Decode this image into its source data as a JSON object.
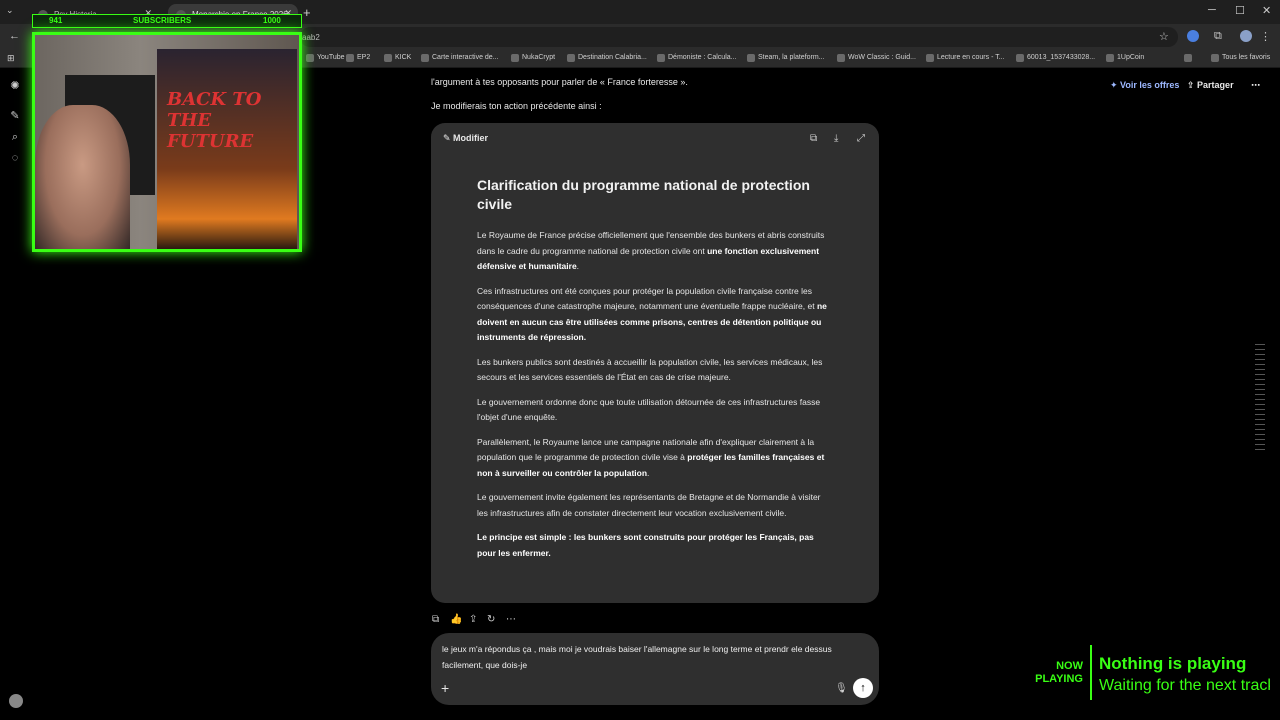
{
  "browser": {
    "tabs": [
      {
        "label": "Psy Historia"
      },
      {
        "label": "Monarchie en France 2026"
      }
    ],
    "url_fragment": "aab2",
    "bookmarks": [
      "YouTube",
      "EP2",
      "KICK",
      "Carte interactive de...",
      "NukaCrypt",
      "Destination Calabria...",
      "Démoniste : Calcula...",
      "Steam, la plateform...",
      "WoW Classic : Guid...",
      "Lecture en cours - T...",
      "60013_1537433028...",
      "1UpCoin"
    ],
    "all_favorites": "Tous les favoris"
  },
  "header": {
    "offers_label": "Voir les offres",
    "share_label": "Partager"
  },
  "conversation": {
    "prev_line": "l'argument à tes opposants pour parler de « France forteresse ».",
    "intro_line": "Je modifierais ton action précédente ainsi :"
  },
  "canvas": {
    "edit_label": "Modifier",
    "title": "Clarification du programme national de protection civile",
    "p1_a": "Le Royaume de France précise officiellement que l'ensemble des bunkers et abris construits dans le cadre du programme national de protection civile ont ",
    "p1_b": "une fonction exclusivement défensive et humanitaire",
    "p1_c": ".",
    "p2_a": "Ces infrastructures ont été conçues pour protéger la population civile française contre les conséquences d'une catastrophe majeure, notamment une éventuelle frappe nucléaire, et ",
    "p2_b": "ne doivent en aucun cas être utilisées comme prisons, centres de détention politique ou instruments de répression.",
    "p3": "Les bunkers publics sont destinés à accueillir la population civile, les services médicaux, les secours et les services essentiels de l'État en cas de crise majeure.",
    "p4": "Le gouvernement ordonne donc que toute utilisation détournée de ces infrastructures fasse l'objet d'une enquête.",
    "p5_a": "Parallèlement, le Royaume lance une campagne nationale afin d'expliquer clairement à la population que le programme de protection civile vise à ",
    "p5_b": "protéger les familles françaises et non à surveiller ou contrôler la population",
    "p5_c": ".",
    "p6": "Le gouvernement invite également les représentants de Bretagne et de Normandie à visiter les infrastructures afin de constater directement leur vocation exclusivement civile.",
    "p7": "Le principe est simple : les bunkers sont construits pour protéger les Français, pas pour les enfermer."
  },
  "composer": {
    "text": "le jeux m'a répondus ça , mais moi je voudrais baiser l'allemagne sur le long terme et prendr ele dessus facilement, que dois-je"
  },
  "overlay": {
    "sub_count": "941",
    "sub_label": "SUBSCRIBERS",
    "sub_goal": "1000",
    "poster_title": "BACK TO THE FUTURE",
    "now_playing": "NOW PLAYING",
    "np_title": "Nothing is playing",
    "np_sub": "Waiting for the next track"
  }
}
